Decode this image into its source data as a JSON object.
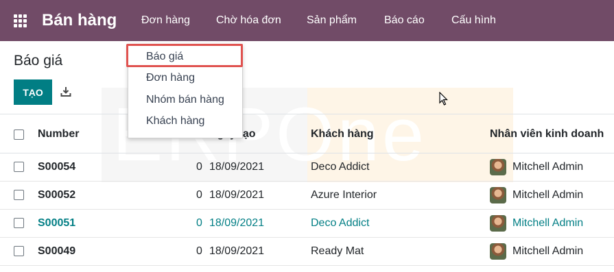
{
  "navbar": {
    "app_name": "Bán hàng",
    "menu": [
      {
        "label": "Đơn hàng"
      },
      {
        "label": "Chờ hóa đơn"
      },
      {
        "label": "Sản phẩm"
      },
      {
        "label": "Báo cáo"
      },
      {
        "label": "Cấu hình"
      }
    ]
  },
  "dropdown": {
    "items": [
      {
        "label": "Báo giá",
        "highlighted": true
      },
      {
        "label": "Đơn hàng"
      },
      {
        "label": "Nhóm bán hàng"
      },
      {
        "label": "Khách hàng"
      }
    ],
    "highlight_color": "#e0524f"
  },
  "control_panel": {
    "title": "Báo giá",
    "create_label": "TẠO",
    "download_icon": "download-icon"
  },
  "watermark": {
    "text": "ERPOne"
  },
  "table": {
    "headers": {
      "number": "Number",
      "date": "Ngày tạo",
      "customer": "Khách hàng",
      "salesperson": "Nhân viên kinh doanh"
    },
    "rows": [
      {
        "number": "S00054",
        "qty": "0",
        "date": "18/09/2021",
        "customer": "Deco Addict",
        "salesperson": "Mitchell Admin"
      },
      {
        "number": "S00052",
        "qty": "0",
        "date": "18/09/2021",
        "customer": "Azure Interior",
        "salesperson": "Mitchell Admin"
      },
      {
        "number": "S00051",
        "qty": "0",
        "date": "18/09/2021",
        "customer": "Deco Addict",
        "salesperson": "Mitchell Admin"
      },
      {
        "number": "S00049",
        "qty": "0",
        "date": "18/09/2021",
        "customer": "Ready Mat",
        "salesperson": "Mitchell Admin"
      }
    ]
  },
  "colors": {
    "navbar": "#714b67",
    "primary_button": "#017e84",
    "link_row": "#017e84"
  }
}
